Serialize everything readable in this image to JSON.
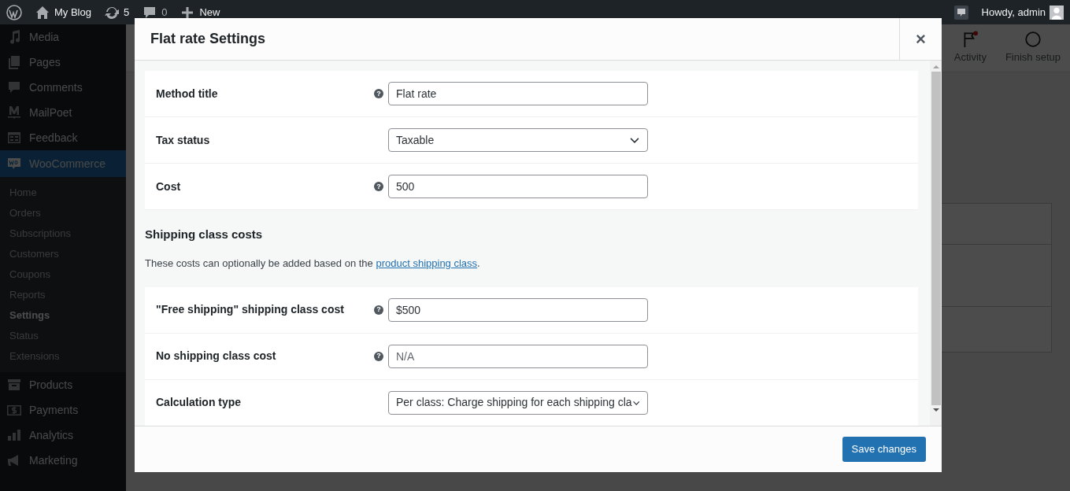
{
  "admin_bar": {
    "site_name": "My Blog",
    "updates": "5",
    "comments": "0",
    "new_label": "New",
    "greeting": "Howdy, admin"
  },
  "sidebar": {
    "items": [
      {
        "label": "Media",
        "selected": false
      },
      {
        "label": "Pages",
        "selected": false
      },
      {
        "label": "Comments",
        "selected": false
      },
      {
        "label": "MailPoet",
        "selected": false
      },
      {
        "label": "Feedback",
        "selected": false
      },
      {
        "label": "WooCommerce",
        "selected": true,
        "children": [
          {
            "label": "Home",
            "selected": false
          },
          {
            "label": "Orders",
            "selected": false
          },
          {
            "label": "Subscriptions",
            "selected": false
          },
          {
            "label": "Customers",
            "selected": false
          },
          {
            "label": "Coupons",
            "selected": false
          },
          {
            "label": "Reports",
            "selected": false
          },
          {
            "label": "Settings",
            "selected": true
          },
          {
            "label": "Status",
            "selected": false
          },
          {
            "label": "Extensions",
            "selected": false
          }
        ]
      },
      {
        "label": "Products",
        "selected": false
      },
      {
        "label": "Payments",
        "selected": false
      },
      {
        "label": "Analytics",
        "selected": false
      },
      {
        "label": "Marketing",
        "selected": false
      }
    ]
  },
  "header_tabs": [
    {
      "label": "Activity",
      "alert": true
    },
    {
      "label": "Finish setup",
      "alert": false
    }
  ],
  "modal": {
    "title": "Flat rate Settings",
    "close": "×",
    "fields": [
      {
        "label": "Method title",
        "help": "?",
        "kind": "text",
        "value": "Flat rate"
      },
      {
        "label": "Tax status",
        "kind": "select",
        "value": "Taxable"
      },
      {
        "label": "Cost",
        "help": "?",
        "kind": "text",
        "value": "500"
      }
    ],
    "section": {
      "heading": "Shipping class costs",
      "description": "These costs can optionally be added based on the ",
      "link": "product shipping class",
      "description_end": "."
    },
    "class_fields": [
      {
        "label": "\"Free shipping\" shipping class cost",
        "help": "?",
        "kind": "text",
        "value": "$500"
      },
      {
        "label": "No shipping class cost",
        "help": "?",
        "kind": "text",
        "placeholder": "N/A"
      },
      {
        "label": "Calculation type",
        "kind": "select",
        "value": "Per class: Charge shipping for each shipping cla"
      }
    ],
    "save_button": "Save changes"
  }
}
